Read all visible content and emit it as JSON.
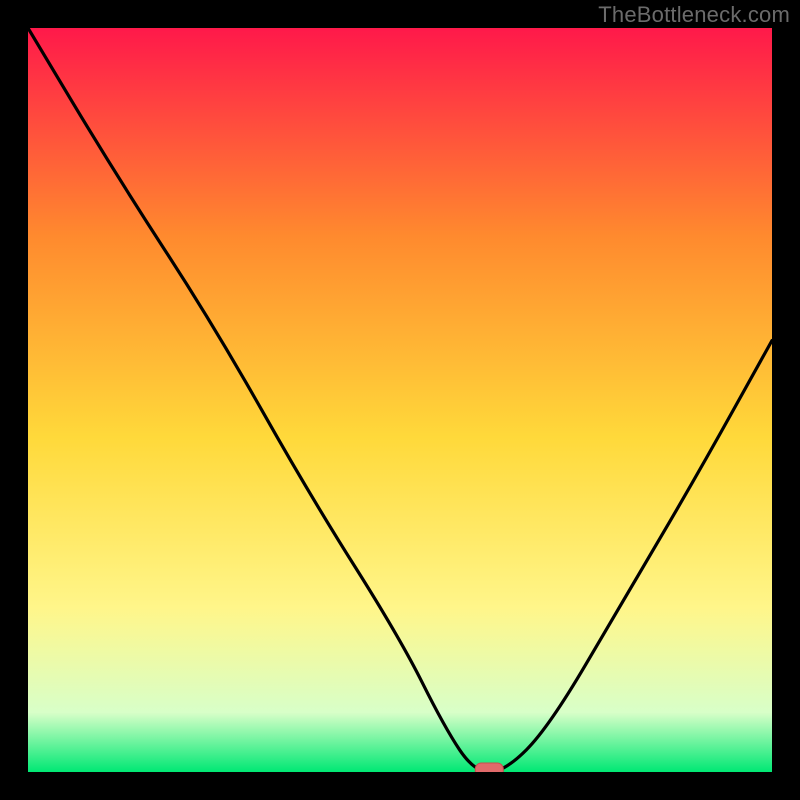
{
  "watermark": "TheBottleneck.com",
  "colors": {
    "bg": "#000000",
    "grad_top": "#ff194a",
    "grad_mid_upper": "#ff8a2e",
    "grad_mid": "#ffd93a",
    "grad_mid_lower": "#fff68a",
    "grad_low": "#d8ffc8",
    "grad_bottom": "#00e874",
    "curve": "#000000",
    "marker_fill": "#e06a6a",
    "marker_stroke": "#c84e4e"
  },
  "chart_data": {
    "type": "line",
    "title": "",
    "xlabel": "",
    "ylabel": "",
    "xlim": [
      0,
      100
    ],
    "ylim": [
      0,
      100
    ],
    "series": [
      {
        "name": "bottleneck-curve",
        "x": [
          0,
          12,
          25,
          38,
          50,
          56,
          60,
          64,
          70,
          80,
          90,
          100
        ],
        "values": [
          100,
          80,
          60,
          37,
          18,
          6,
          0,
          0,
          6,
          23,
          40,
          58
        ]
      }
    ],
    "marker": {
      "x": 62,
      "y": 0,
      "name": "optimal-point"
    }
  }
}
